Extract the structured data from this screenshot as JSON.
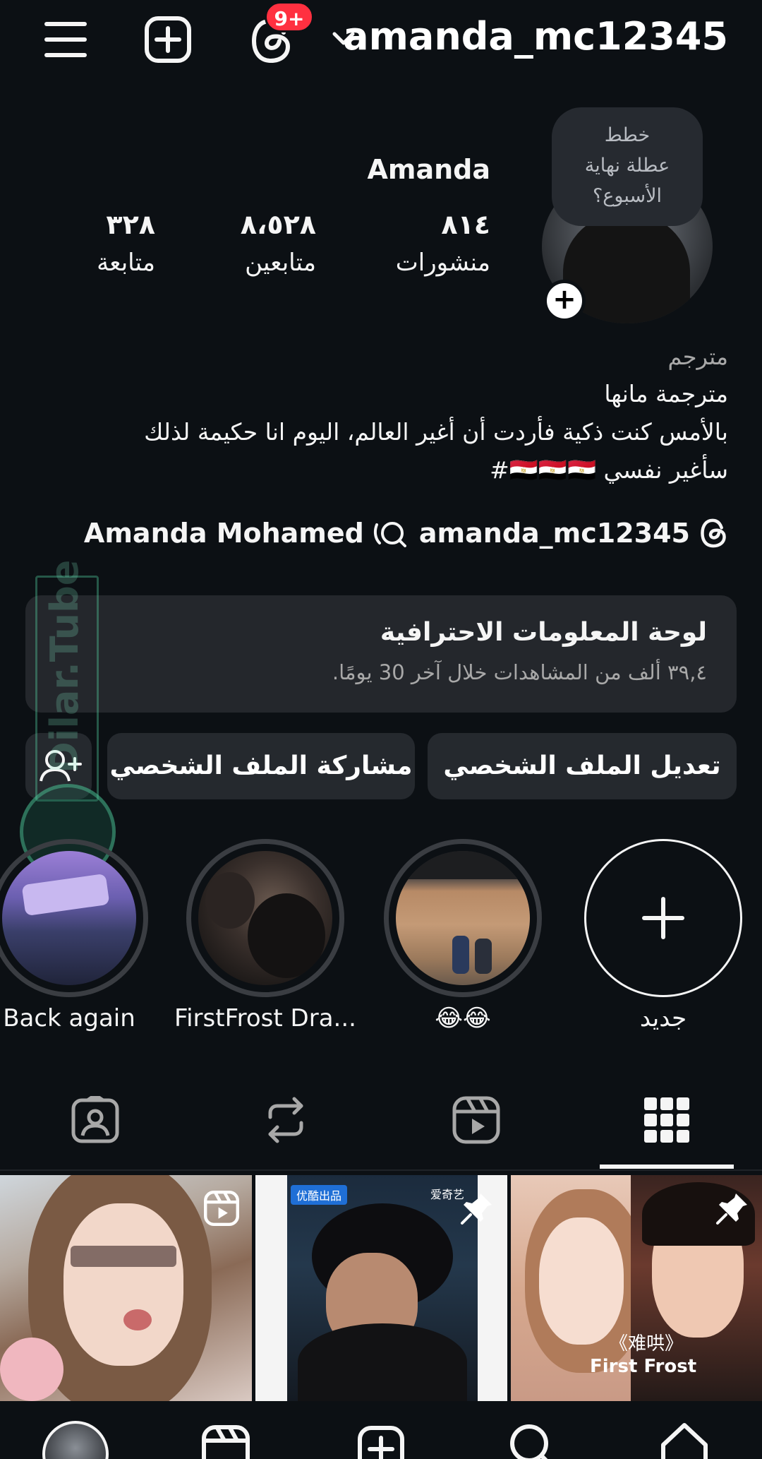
{
  "header": {
    "username": "amanda_mc12345",
    "notification_badge": "9+"
  },
  "profile": {
    "display_name": "Amanda",
    "note_lines": [
      "خطط",
      "عطلة نهاية",
      "الأسبوع؟"
    ],
    "add_story_symbol": "+",
    "stats": [
      {
        "value": "٨١٤",
        "label": "منشورات"
      },
      {
        "value": "٨،٥٢٨",
        "label": "متابعين"
      },
      {
        "value": "٣٢٨",
        "label": "متابعة"
      }
    ]
  },
  "bio": {
    "category": "مترجم",
    "lines": [
      "مترجمة مانها",
      "بالأمس كنت ذكية فأردت أن أغير العالم، اليوم انا حكيمة لذلك",
      "سأغير نفسي 🇪🇬🇪🇬🇪🇬#"
    ],
    "threads_handle": "amanda_mc12345",
    "linked_name": "Amanda Mohamed"
  },
  "dashboard": {
    "title": "لوحة المعلومات الاحترافية",
    "subtitle": "٣٩,٤ ألف من المشاهدات خلال آخر 30 يومًا."
  },
  "actions": {
    "edit_profile": "تعديل الملف الشخصي",
    "share_profile": "مشاركة الملف الشخصي"
  },
  "watermark": {
    "text": "Dilar.Tube"
  },
  "highlights": [
    {
      "label": "جديد",
      "icon": "plus-icon"
    },
    {
      "label": "😂😂"
    },
    {
      "label": "FirstFrost Dra..."
    },
    {
      "label": "Back again"
    }
  ],
  "tabs": [
    {
      "name": "posts-grid",
      "icon": "grid-icon",
      "selected": true
    },
    {
      "name": "reels",
      "icon": "reels-icon",
      "selected": false
    },
    {
      "name": "reposts",
      "icon": "repost-icon",
      "selected": false
    },
    {
      "name": "tagged",
      "icon": "tagged-icon",
      "selected": false
    }
  ],
  "grid": [
    {
      "kind": "reel",
      "icon": "reel-icon"
    },
    {
      "kind": "pinned",
      "icon": "pin-icon",
      "text_top_left": "优酷出品",
      "text_top_right": "爱奇艺"
    },
    {
      "kind": "pinned",
      "icon": "pin-icon",
      "caption_line1": "《难哄》",
      "caption_line2": "First Frost"
    }
  ],
  "colors": {
    "background": "#0c1014",
    "surface": "#24272c",
    "badge": "#ff3040",
    "text": "#f5f5f5",
    "muted": "#a8a8a8"
  }
}
